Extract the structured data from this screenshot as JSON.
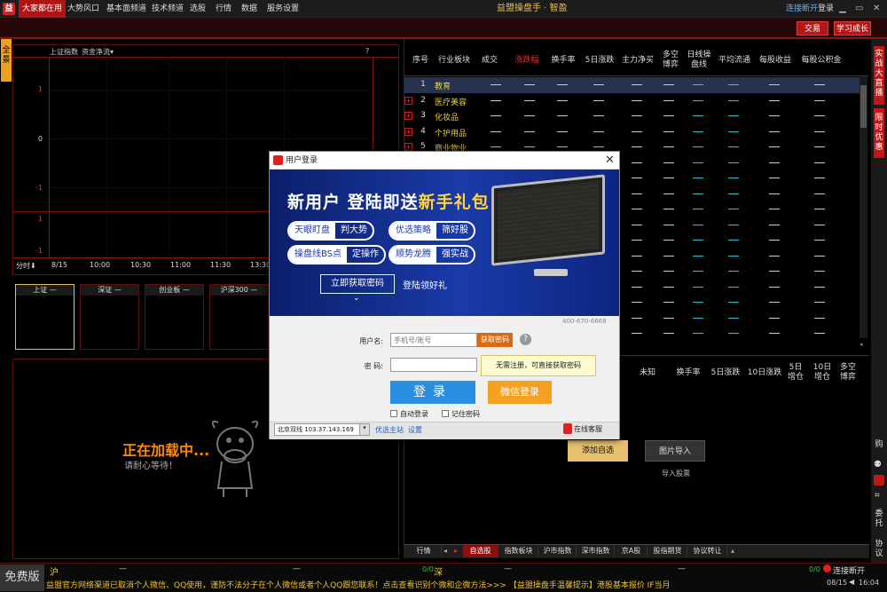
{
  "menubar": {
    "items": [
      "大家都在用",
      "大势风口",
      "基本面频道",
      "技术频道",
      "选股",
      "行情",
      "数据",
      "服务设置"
    ],
    "title": "益盟操盘手 · 智盈",
    "connect": "连接断开",
    "login": "登录"
  },
  "toolbar": {
    "trade": "交易",
    "learn": "学习成长"
  },
  "left_tab": "全景",
  "chart": {
    "label_index": "上证指数",
    "label_flow": "资金净流▾",
    "help": "?",
    "y_ticks": [
      "1",
      "0",
      "-1",
      "1",
      "-1"
    ],
    "x_ticks": [
      "分时⬇",
      "8/15",
      "10:00",
      "10:30",
      "11:00",
      "11:30",
      "13:30"
    ]
  },
  "quotes": [
    {
      "name": "上证",
      "value": "—"
    },
    {
      "name": "深证",
      "value": "—"
    },
    {
      "name": "创业板",
      "value": "—"
    },
    {
      "name": "沪深300",
      "value": "—"
    }
  ],
  "loading": {
    "text": "正在加载中...",
    "sub": "请耐心等待！"
  },
  "table": {
    "headers": [
      "序号",
      "行业板块",
      "成交",
      "涨跌幅",
      "换手率",
      "5日涨跌",
      "主力净买",
      "多空\n博弈",
      "日线操\n盘线",
      "平均流通",
      "每股收益",
      "每股公积金"
    ],
    "rows": [
      {
        "n": "1",
        "name": "教育"
      },
      {
        "n": "2",
        "name": "医疗美容"
      },
      {
        "n": "3",
        "name": "化妆品"
      },
      {
        "n": "4",
        "name": "个护用品"
      },
      {
        "n": "5",
        "name": "商业物业"
      }
    ],
    "dash": "—"
  },
  "lower": {
    "headers": [
      "未知",
      "换手率",
      "5日涨跌",
      "10日涨跌",
      "5日\n增仓",
      "10日\n增仓",
      "多空\n博弈"
    ],
    "add_button": "添加自选",
    "import_button": "图片导入",
    "import_caption": "导入股票"
  },
  "right_tabs": [
    "实战大直播",
    "限时优惠",
    "购",
    "委托",
    "协议"
  ],
  "bottom_tabs": [
    "行情",
    "自选股",
    "指数板块",
    "沪市指数",
    "深市指数",
    "京A股",
    "股指期货",
    "协议转让"
  ],
  "status": {
    "free": "免费版",
    "sh_label": "沪",
    "sh_value": "—",
    "sh_right": "—",
    "sh_ratio": "0/0",
    "sz_label": "深",
    "sz_value": "—",
    "sz_right": "—",
    "sz_ratio": "0/0",
    "connect": "连接断开",
    "ticker": "益盟官方网络渠道已取消个人微信、QQ使用，谨防不法分子在个人微信或者个人QQ跟您联系！点击查看识别个微和企微方法>>>   【益盟操盘手温馨提示】港股基本报价  IF当月",
    "date": "08/15",
    "time": "16:04"
  },
  "dialog": {
    "title": "用户登录",
    "close": "✕",
    "banner_head_a": "新用户  登陆即送",
    "banner_head_b": "新手礼包",
    "pills": [
      {
        "a": "天眼盯盘",
        "b": "判大势"
      },
      {
        "a": "优选策略",
        "b": "筛好股"
      },
      {
        "a": "操盘线BS点",
        "b": "定操作"
      },
      {
        "a": "顺势龙腾",
        "b": "强实战"
      }
    ],
    "banner_button": "立即获取密码",
    "banner_sub": "登陆领好礼",
    "phone": "400-670-6668",
    "user_label": "用户名:",
    "user_placeholder": "手机号/账号",
    "get_code": "获取密码",
    "help": "?",
    "pwd_label": "密  码:",
    "tip": "无需注册，可直接获取密码",
    "login": "登录",
    "wechat": "微信登录",
    "auto_login": "自动登录",
    "remember": "记住密码",
    "server": "北京双线 103.37.143.169",
    "link_select": "优选主站",
    "link_settings": "设置",
    "service": "在线客服"
  },
  "colors": {
    "accent": "#b01515",
    "yellow": "#e8d040",
    "login_blue": "#2a8fe0",
    "wechat_orange": "#f5a020"
  }
}
